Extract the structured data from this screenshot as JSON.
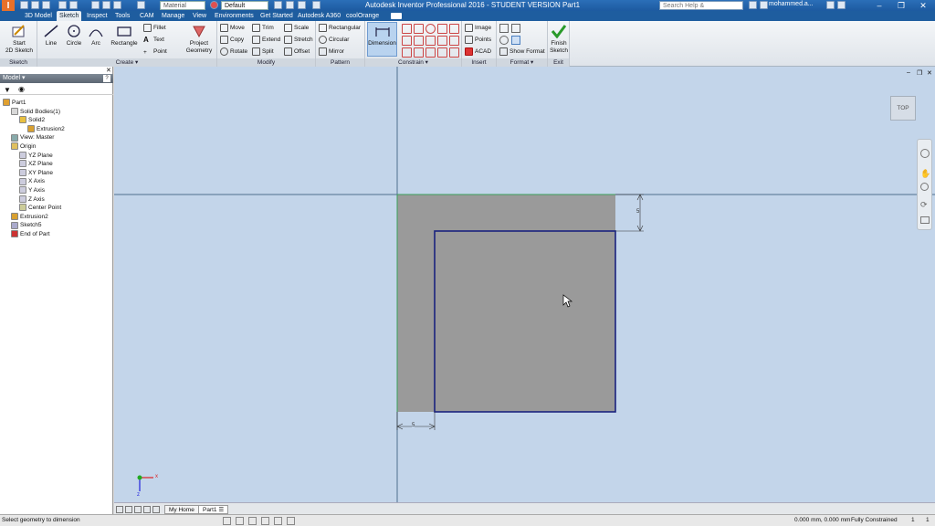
{
  "window": {
    "title": "Autodesk Inventor Professional 2016 - STUDENT VERSION    Part1",
    "material_placeholder": "Material",
    "appearance": "Default",
    "search_placeholder": "Search Help & Commands...",
    "user": "mohammed.a..."
  },
  "menu_tabs": [
    "3D Model",
    "Sketch",
    "Inspect",
    "Tools",
    "CAM",
    "Manage",
    "View",
    "Environments",
    "Get Started",
    "Autodesk A360",
    "coolOrange"
  ],
  "ribbon": {
    "sketch": {
      "start": "Start\n2D Sketch",
      "label": "Sketch"
    },
    "create": {
      "line": "Line",
      "circle": "Circle",
      "arc": "Arc",
      "rectangle": "Rectangle",
      "fillet": "Fillet",
      "text": "Text",
      "point": "Point",
      "project": "Project\nGeometry",
      "label": "Create"
    },
    "modify": {
      "move": "Move",
      "copy": "Copy",
      "rotate": "Rotate",
      "trim": "Trim",
      "extend": "Extend",
      "split": "Split",
      "scale": "Scale",
      "stretch": "Stretch",
      "offset": "Offset",
      "label": "Modify"
    },
    "pattern": {
      "rectangular": "Rectangular",
      "circular": "Circular",
      "mirror": "Mirror",
      "label": "Pattern"
    },
    "constrain": {
      "dimension": "Dimension",
      "label": "Constrain"
    },
    "insert": {
      "image": "Image",
      "points": "Points",
      "acad": "ACAD",
      "label": "Insert"
    },
    "format": {
      "show_format": "Show Format",
      "label": "Format"
    },
    "exit": {
      "finish": "Finish\nSketch",
      "label": "Exit"
    }
  },
  "browser": {
    "title": "Model",
    "tree": [
      {
        "label": "Part1",
        "indent": 0
      },
      {
        "label": "Solid Bodies(1)",
        "indent": 1
      },
      {
        "label": "Solid2",
        "indent": 2
      },
      {
        "label": "Extrusion2",
        "indent": 3
      },
      {
        "label": "View: Master",
        "indent": 1
      },
      {
        "label": "Origin",
        "indent": 1
      },
      {
        "label": "YZ Plane",
        "indent": 2
      },
      {
        "label": "XZ Plane",
        "indent": 2
      },
      {
        "label": "XY Plane",
        "indent": 2
      },
      {
        "label": "X Axis",
        "indent": 2
      },
      {
        "label": "Y Axis",
        "indent": 2
      },
      {
        "label": "Z Axis",
        "indent": 2
      },
      {
        "label": "Center Point",
        "indent": 2
      },
      {
        "label": "Extrusion2",
        "indent": 1
      },
      {
        "label": "Sketch5",
        "indent": 1
      },
      {
        "label": "End of Part",
        "indent": 1
      }
    ]
  },
  "viewcube": "TOP",
  "doc_tabs": [
    "My Home",
    "Part1"
  ],
  "status": {
    "prompt": "Select geometry to dimension",
    "coords": "0.000 mm, 0.000 mm",
    "constraint": "Fully Constrained",
    "n1": "1",
    "n2": "1"
  },
  "dims": {
    "width": "5",
    "height": "5"
  },
  "colors": {
    "title_bar": "#1d5aa0",
    "canvas_bg": "#c3d5ea",
    "sketch_line": "#1a237e",
    "body": "#9a9a9a"
  }
}
